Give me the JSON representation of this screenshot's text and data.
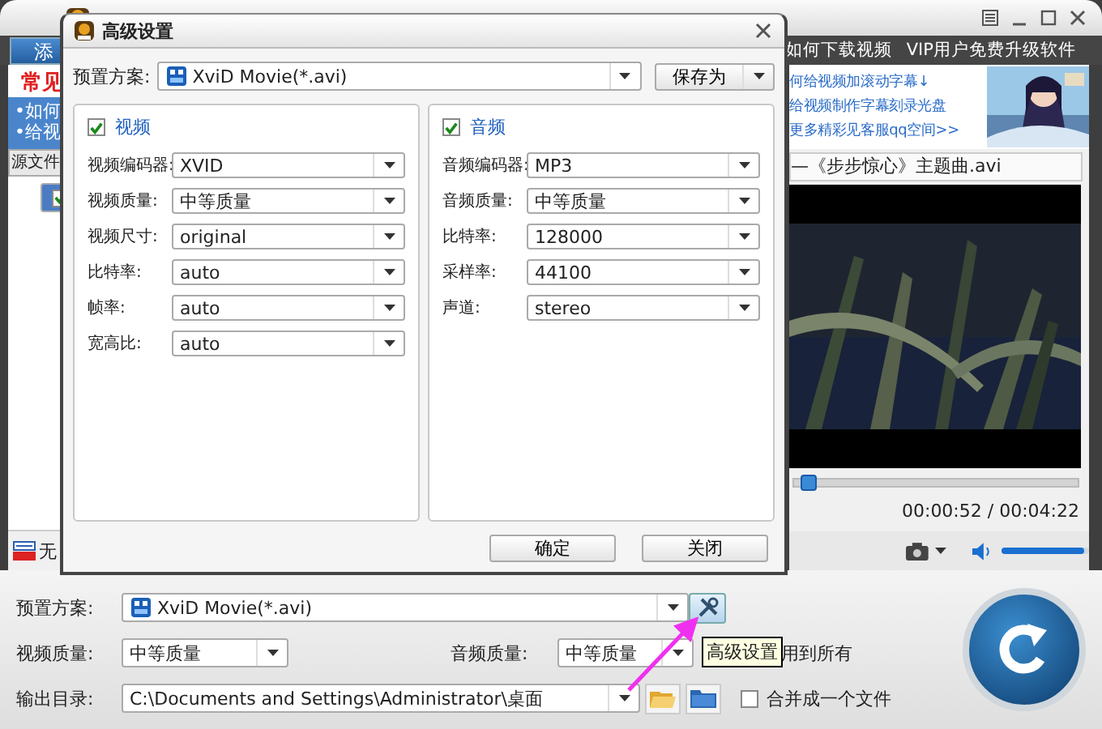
{
  "toolbar": {
    "add_button": "添",
    "links": [
      "如何下载视频",
      "VIP用户免费升级软件"
    ]
  },
  "tips": {
    "heading": "常见",
    "items": [
      "•如何",
      "•给视"
    ]
  },
  "ad": {
    "links": [
      "何给视频加滚动字幕↓",
      "给视频制作字幕刻录光盘",
      "更多精彩见客服qq空间>>"
    ]
  },
  "file_list": {
    "header": "源文件",
    "rows": [
      {
        "checked": true
      }
    ]
  },
  "preview": {
    "file_title": "—《步步惊心》主题曲.avi",
    "progress": {
      "level": 0.02
    },
    "time": "00:00:52 / 00:04:22",
    "volume": {
      "level": 0.95
    }
  },
  "subtitle": {
    "label": "无"
  },
  "settings": {
    "preset_label": "预置方案:",
    "preset": "XviD Movie(*.avi)",
    "video_quality_label": "视频质量:",
    "video_quality": "中等质量",
    "audio_quality_label": "音频质量:",
    "audio_quality": "中等质量",
    "apply_all_label": "用到所有",
    "output_label": "输出目录:",
    "output_path": "C:\\Documents and Settings\\Administrator\\桌面",
    "merge": {
      "label": "合并成一个文件",
      "checked": false
    }
  },
  "tooltip": "高级设置",
  "dialog": {
    "title": "高级设置",
    "preset_label": "预置方案:",
    "preset": "XviD Movie(*.avi)",
    "save_as": "保存为",
    "groups": [
      {
        "title": "视频",
        "checked": true,
        "fields": [
          {
            "label": "视频编码器:",
            "value": "XVID"
          },
          {
            "label": "视频质量:",
            "value": "中等质量"
          },
          {
            "label": "视频尺寸:",
            "value": "original"
          },
          {
            "label": "比特率:",
            "value": "auto"
          },
          {
            "label": "帧率:",
            "value": "auto"
          },
          {
            "label": "宽高比:",
            "value": "auto"
          }
        ]
      },
      {
        "title": "音频",
        "checked": true,
        "fields": [
          {
            "label": "音频编码器:",
            "value": "MP3"
          },
          {
            "label": "音频质量:",
            "value": "中等质量"
          },
          {
            "label": "比特率:",
            "value": "128000"
          },
          {
            "label": "采样率:",
            "value": "44100"
          },
          {
            "label": "声道:",
            "value": "stereo"
          }
        ]
      }
    ],
    "buttons": [
      "确定",
      "关闭"
    ]
  }
}
